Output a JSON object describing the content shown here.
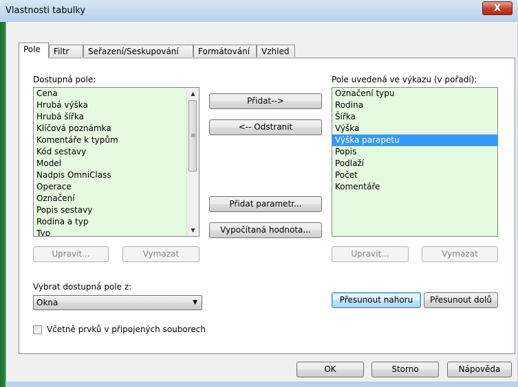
{
  "window": {
    "title": "Vlastnosti tabulky",
    "close_glyph": "X"
  },
  "tabs": [
    {
      "label": "Pole",
      "active": true
    },
    {
      "label": "Filtr",
      "active": false
    },
    {
      "label": "Seřazení/Seskupování",
      "active": false
    },
    {
      "label": "Formátování",
      "active": false
    },
    {
      "label": "Vzhled",
      "active": false
    }
  ],
  "available": {
    "label": "Dostupná pole:",
    "items": [
      "Cena",
      "Hrubá výška",
      "Hrubá šířka",
      "Klíčová poznámka",
      "Komentáře k typům",
      "Kód sestavy",
      "Model",
      "Nadpis OmniClass",
      "Operace",
      "Označení",
      "Popis sestavy",
      "Rodina a typ",
      "Typ"
    ]
  },
  "scheduled": {
    "label": "Pole uvedená ve výkazu (v pořadí):",
    "items": [
      "Označení typu",
      "Rodina",
      "Šířka",
      "Výška",
      "Výška parapetu",
      "Popis",
      "Podlaží",
      "Počet",
      "Komentáře"
    ],
    "selected_index": 4
  },
  "middle_buttons": {
    "add": "Přidat-->",
    "remove": "<-- Odstranit",
    "add_parameter": "Přidat parametr...",
    "calculated_value": "Vypočítaná hodnota..."
  },
  "left_buttons": {
    "edit": "Upravit...",
    "delete": "Vymazat"
  },
  "right_buttons": {
    "edit": "Upravit...",
    "delete": "Vymazat",
    "move_up": "Přesunout nahoru",
    "move_down": "Přesunout dolů"
  },
  "select_from": {
    "label": "Vybrat dostupná pole z:",
    "value": "Okna"
  },
  "include_linked": {
    "label": "Včetně prvků v připojených souborech",
    "checked": false
  },
  "footer": {
    "ok": "OK",
    "cancel": "Storno",
    "help": "Nápověda"
  }
}
